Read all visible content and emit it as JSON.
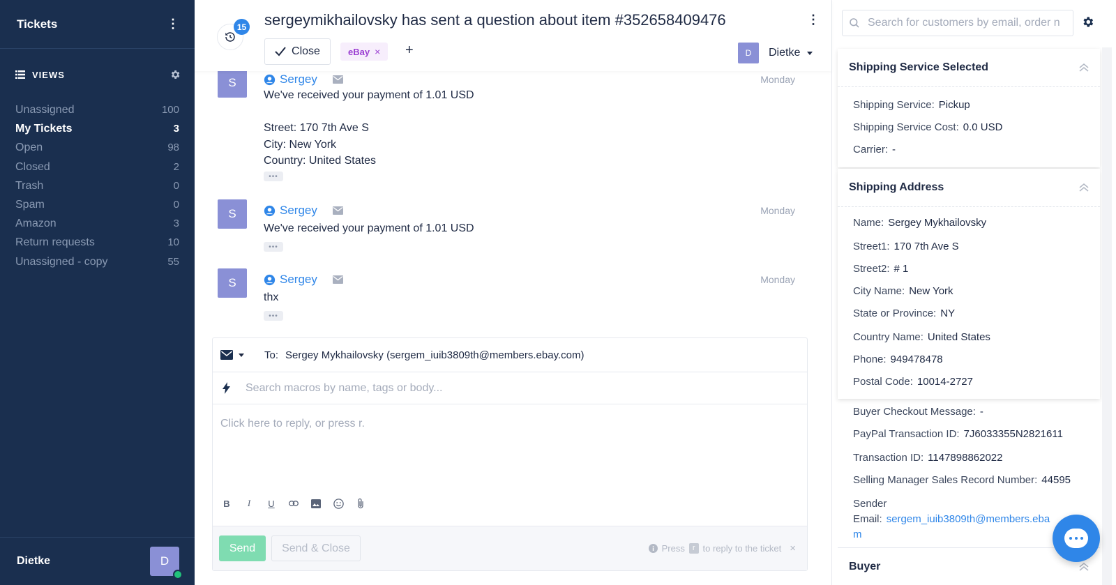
{
  "sidebar": {
    "title": "Tickets",
    "views_label": "VIEWS",
    "views": [
      {
        "label": "Unassigned",
        "count": "100"
      },
      {
        "label": "My Tickets",
        "count": "3"
      },
      {
        "label": "Open",
        "count": "98"
      },
      {
        "label": "Closed",
        "count": "2"
      },
      {
        "label": "Trash",
        "count": "0"
      },
      {
        "label": "Spam",
        "count": "0"
      },
      {
        "label": "Amazon",
        "count": "3"
      },
      {
        "label": "Return requests",
        "count": "10"
      },
      {
        "label": "Unassigned - copy",
        "count": "55"
      }
    ],
    "active_view": "My Tickets",
    "user": {
      "name": "Dietke",
      "initial": "D",
      "status": "online"
    }
  },
  "ticket": {
    "history_count": "15",
    "subject": "sergeymikhailovsky has sent a question about item #352658409476",
    "close_label": "Close",
    "tag": "eBay",
    "tag_remove": "×",
    "add_tag": "+",
    "assignee": {
      "initial": "D",
      "name": "Dietke"
    }
  },
  "messages": [
    {
      "initial": "S",
      "sender": "Sergey",
      "time": "Monday",
      "body": "We've received your payment of 1.01 USD\n\nStreet: 170 7th Ave S\nCity: New York\nCountry: United States",
      "more": "•••"
    },
    {
      "initial": "S",
      "sender": "Sergey",
      "time": "Monday",
      "body": "We've received your payment of 1.01 USD",
      "more": "•••"
    },
    {
      "initial": "S",
      "sender": "Sergey",
      "time": "Monday",
      "body": "thx",
      "more": "•••"
    }
  ],
  "composer": {
    "to_label": "To:",
    "to_value": "Sergey Mykhailovsky (sergem_iuib3809th@members.ebay.com)",
    "macro_placeholder": "Search macros by name, tags or body...",
    "reply_placeholder": "Click here to reply, or press r.",
    "tools": [
      "B",
      "I",
      "U",
      "link-icon",
      "image-icon",
      "emoji-icon",
      "attachment-icon"
    ],
    "send_label": "Send",
    "send_close_label": "Send & Close",
    "hint_prefix": "Press",
    "hint_key": "r",
    "hint_suffix": "to reply to the ticket",
    "hint_close": "×"
  },
  "right": {
    "search_placeholder": "Search for customers by email, order n",
    "shipping_service": {
      "title": "Shipping Service Selected",
      "fields": [
        {
          "k": "Shipping Service:",
          "v": "Pickup"
        },
        {
          "k": "Shipping Service Cost:",
          "v": "0.0 USD"
        },
        {
          "k": "Carrier:",
          "v": "-"
        }
      ]
    },
    "shipping_address": {
      "title": "Shipping Address",
      "fields": [
        {
          "k": "Name:",
          "v": "Sergey Mykhailovsky"
        },
        {
          "k": "Street1:",
          "v": "170 7th Ave S"
        },
        {
          "k": "Street2:",
          "v": "# 1"
        },
        {
          "k": "City Name:",
          "v": "New York"
        },
        {
          "k": "State or Province:",
          "v": "NY"
        },
        {
          "k": "Country Name:",
          "v": "United States"
        },
        {
          "k": "Phone:",
          "v": "949478478"
        },
        {
          "k": "Postal Code:",
          "v": "10014-2727"
        }
      ]
    },
    "extra_fields": [
      {
        "k": "Buyer Checkout Message:",
        "v": "-"
      },
      {
        "k": "PayPal Transaction ID:",
        "v": "7J6033355N2821611"
      },
      {
        "k": "Transaction ID:",
        "v": "1147898862022"
      },
      {
        "k": "Selling Manager Sales Record Number:",
        "v": "44595"
      }
    ],
    "sender_label": "Sender",
    "sender_email_label": "Email:",
    "sender_email_line1": "sergem_iuib3809th@members.eba",
    "sender_email_line2": "m",
    "buyer_title": "Buyer"
  },
  "colors": {
    "sidebar_bg": "#1a2f4f",
    "accent": "#2f86e8",
    "tag": "#9b3fd2",
    "send": "#7fdcb1",
    "avatar": "#8a90d6"
  }
}
